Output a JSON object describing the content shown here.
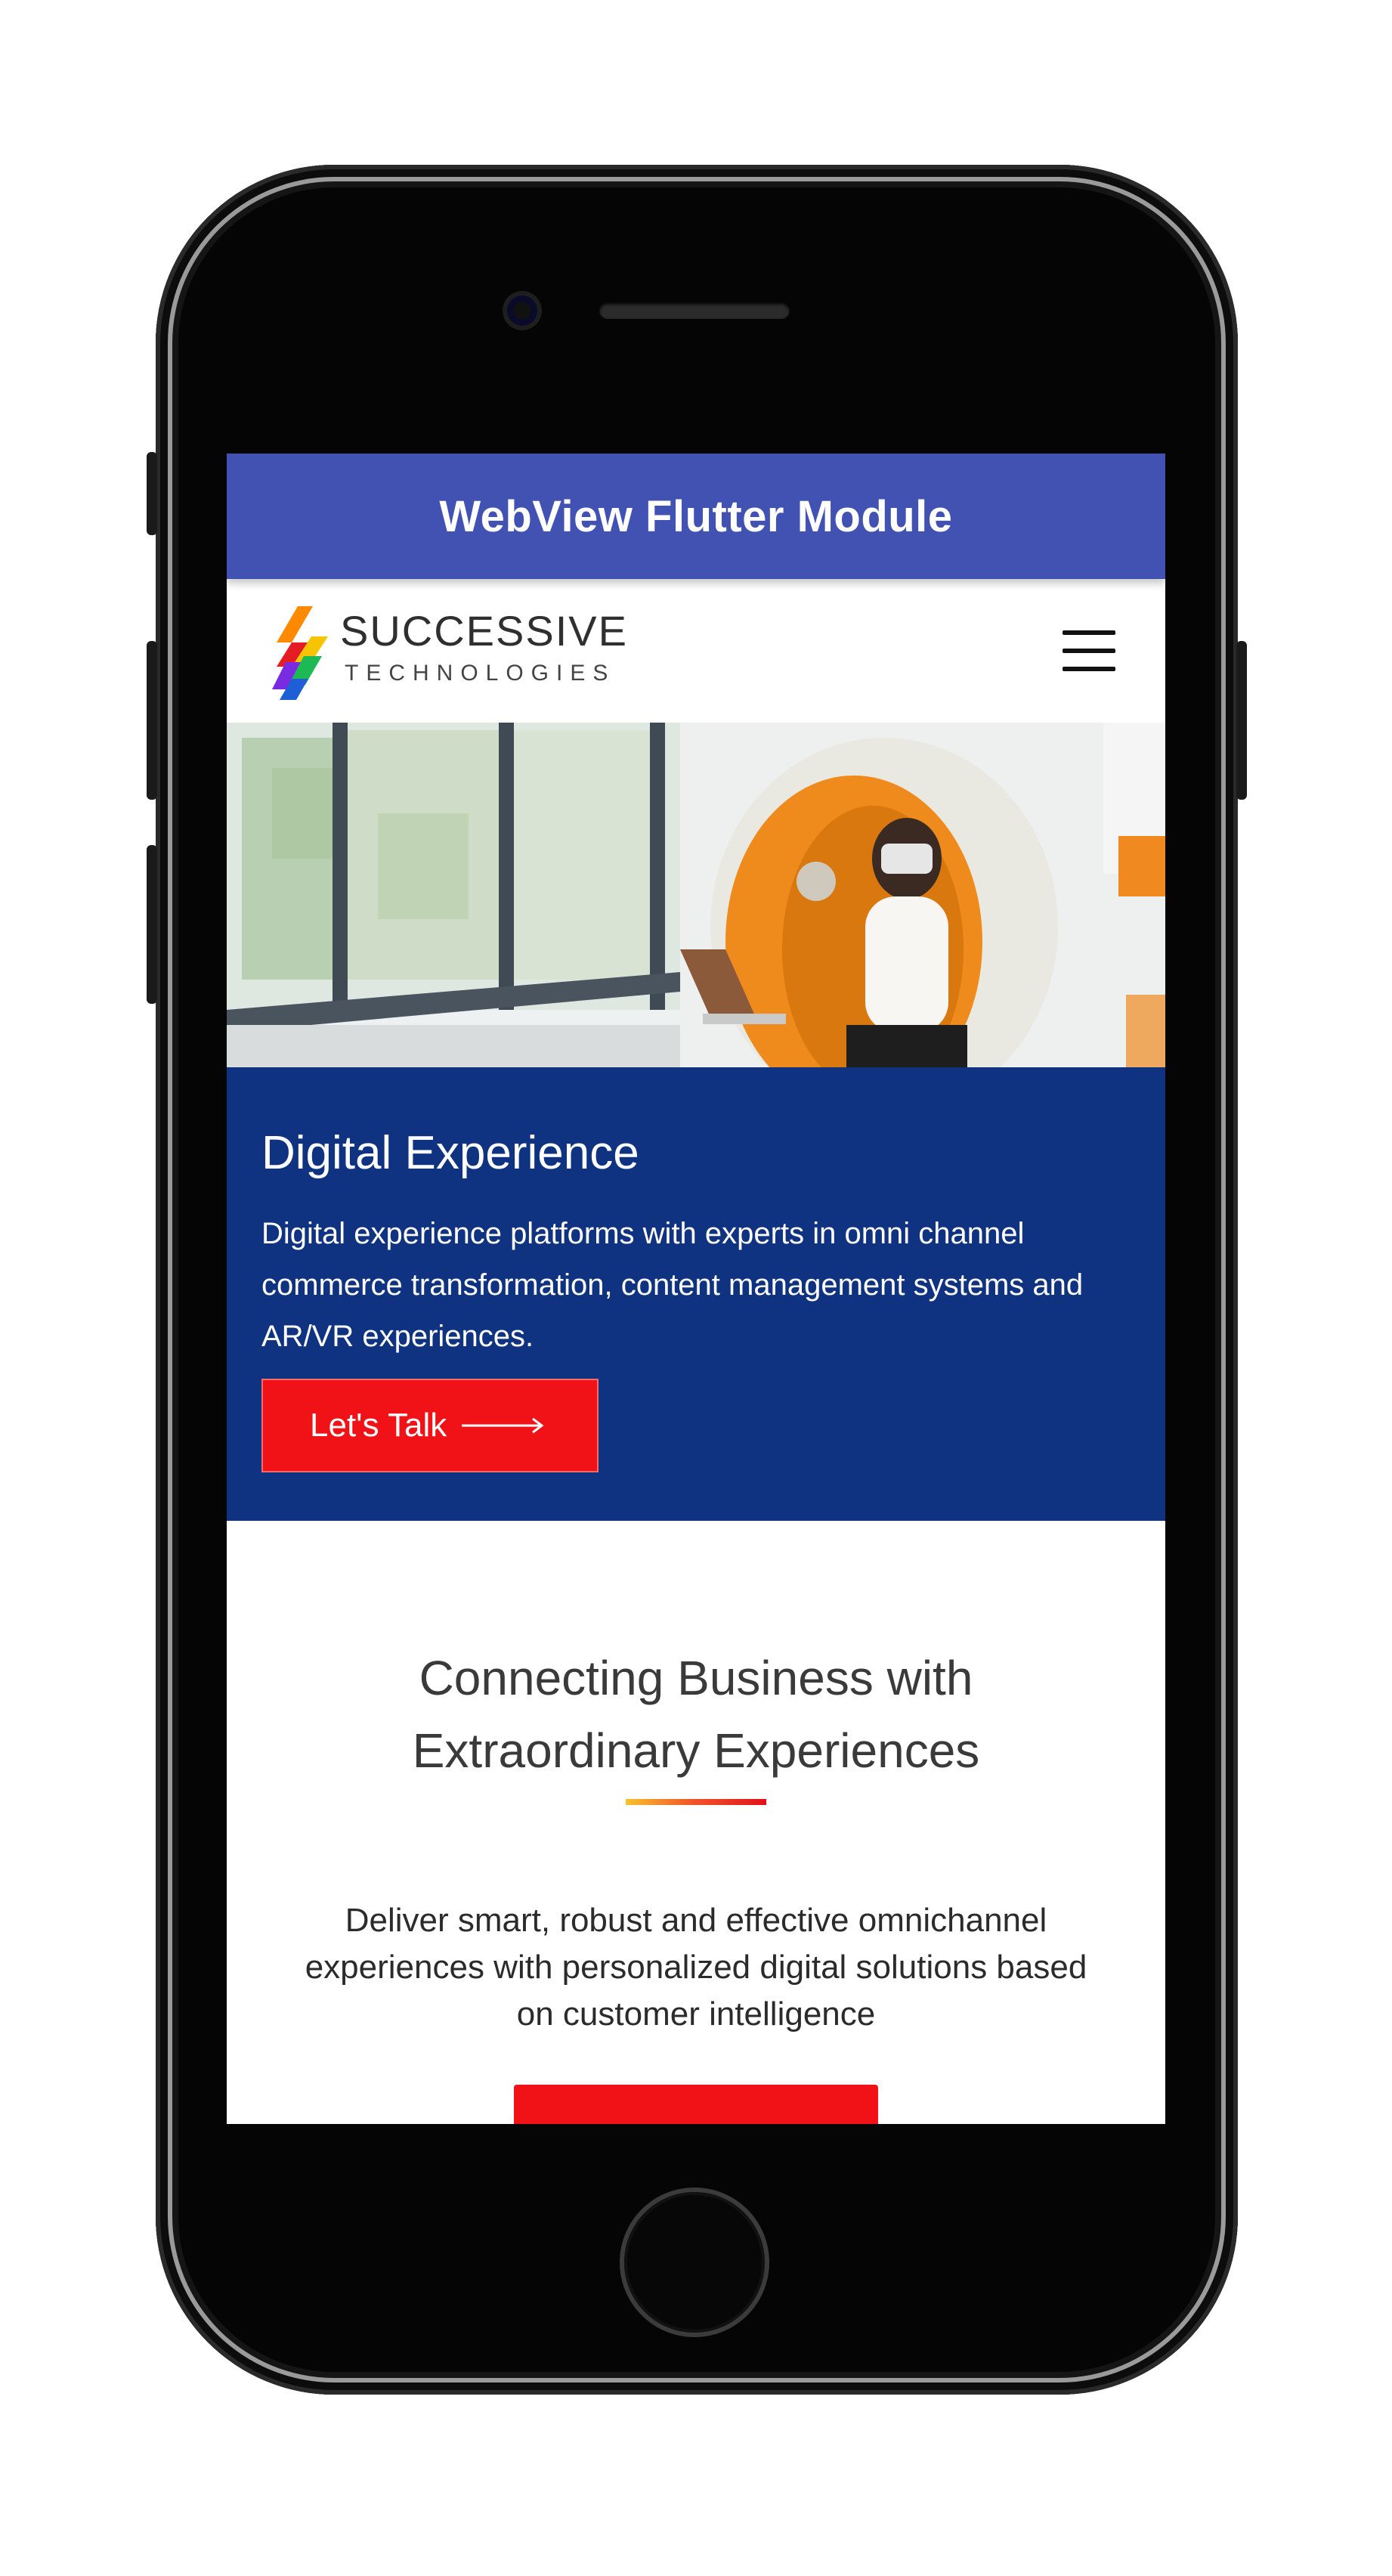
{
  "app": {
    "title": "WebView Flutter Module"
  },
  "header": {
    "logo_line1": "SUCCESSIVE",
    "logo_line2": "TECHNOLOGIES",
    "menu_icon": "hamburger-menu-icon"
  },
  "hero": {
    "image_subject": "woman-vr-headset-photo"
  },
  "banner": {
    "title": "Digital Experience",
    "text": "Digital experience platforms with experts in omni channel commerce transformation, content management systems and AR/VR experiences.",
    "cta_label": "Let's Talk",
    "cta_icon": "long-arrow-right-icon",
    "background_color": "#0f3381",
    "cta_color": "#f01217"
  },
  "section": {
    "title_line1": "Connecting Business with",
    "title_line2": "Extraordinary Experiences",
    "text": "Deliver smart, robust and effective omnichannel experiences with personalized digital solutions based on customer intelligence"
  },
  "colors": {
    "appbar": "#4152b3",
    "accent": "#f01217"
  }
}
